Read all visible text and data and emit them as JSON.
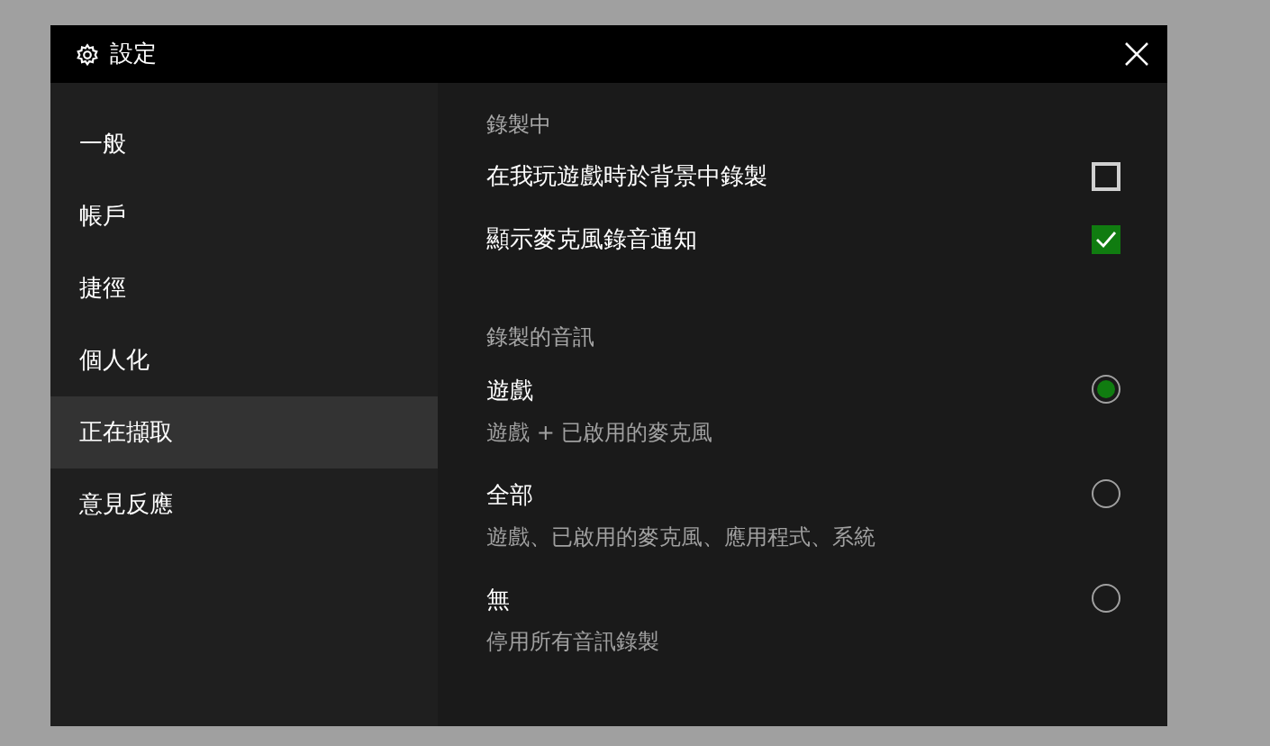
{
  "window": {
    "title": "設定"
  },
  "sidebar": {
    "items": [
      {
        "label": "一般",
        "selected": false
      },
      {
        "label": "帳戶",
        "selected": false
      },
      {
        "label": "捷徑",
        "selected": false
      },
      {
        "label": "個人化",
        "selected": false
      },
      {
        "label": "正在擷取",
        "selected": true
      },
      {
        "label": "意見反應",
        "selected": false
      }
    ]
  },
  "sections": [
    {
      "heading": "錄製中",
      "items": [
        {
          "kind": "checkbox",
          "label": "在我玩遊戲時於背景中錄製",
          "checked": false
        },
        {
          "kind": "checkbox",
          "label": "顯示麥克風錄音通知",
          "checked": true
        }
      ]
    },
    {
      "heading": "錄製的音訊",
      "items": [
        {
          "kind": "radio",
          "label": "遊戲",
          "description": "遊戲 + 已啟用的麥克風",
          "selected": true
        },
        {
          "kind": "radio",
          "label": "全部",
          "description": "遊戲、已啟用的麥克風、應用程式、系統",
          "selected": false
        },
        {
          "kind": "radio",
          "label": "無",
          "description": "停用所有音訊錄製",
          "selected": false
        }
      ]
    }
  ]
}
